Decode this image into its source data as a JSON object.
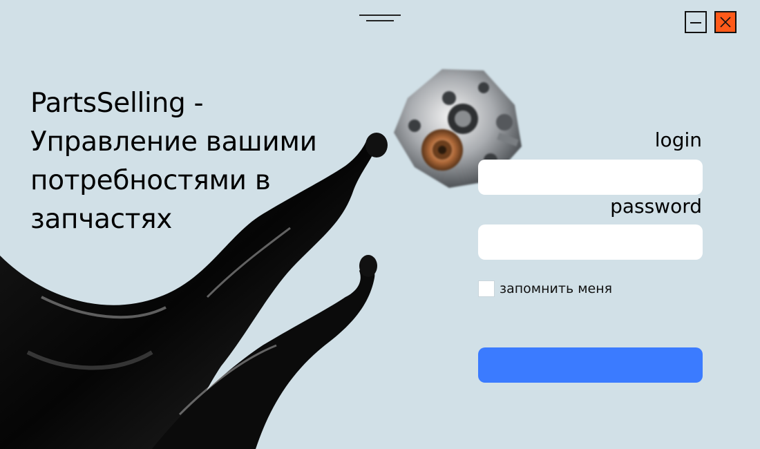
{
  "window": {
    "drag_handle_icon": "drag-handle-icon",
    "minimize_icon": "minimize-icon",
    "close_icon": "close-icon",
    "close_color": "#ff5a1a"
  },
  "hero": {
    "title": "PartsSelling - Управление вашими потребностями в запчастях"
  },
  "login_form": {
    "login_label": "login",
    "login_value": "",
    "password_label": "password",
    "password_value": "",
    "remember_label": "запомнить меня",
    "remember_checked": false,
    "submit_label": "",
    "accent_color": "#3b7bff"
  },
  "colors": {
    "background": "#d1e0e7",
    "field_background": "#ffffff"
  }
}
